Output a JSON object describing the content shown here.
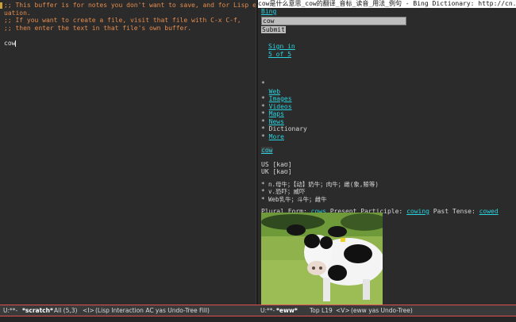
{
  "left_buffer": {
    "comment_lines": [
      ";; This buffer is for notes you don't want to save, and for Lisp eva",
      "uation.",
      ";; If you want to create a file, visit that file with C-x C-f,",
      ";; then enter the text in that file's own buffer."
    ],
    "body_text": "cow"
  },
  "right_buffer": {
    "title": "cow是什么意思_cow的翻译_音标_读音_用法_例句 - Bing Dictionary: http://cn.bing.",
    "bing_link": "Bing",
    "search_value": "cow",
    "submit_label": "Submit",
    "sign_in": "Sign in",
    "pager": "5 of 5",
    "nav": [
      {
        "bullet": "*",
        "label": ""
      },
      {
        "bullet": "",
        "label": "Web"
      },
      {
        "bullet": "*",
        "label": "Images"
      },
      {
        "bullet": "*",
        "label": "Videos"
      },
      {
        "bullet": "*",
        "label": "Maps"
      },
      {
        "bullet": "*",
        "label": "News"
      },
      {
        "bullet": "*",
        "label": "Dictionary"
      },
      {
        "bullet": "*",
        "label": "More"
      }
    ],
    "headword": "cow",
    "pron_us": "US [kaʊ]",
    "pron_uk": "UK [kaʊ]",
    "definitions": [
      "* n.母牛；【动】奶牛；肉牛；雌(象,鲸等)",
      "* v.恐吓；威吓",
      "* Web乳牛；斗牛；雌牛"
    ],
    "forms": {
      "plural_label": "Plural Form:",
      "plural": "cows",
      "present_label": "Present Participle:",
      "present": "cowing",
      "past_label": "Past Tense:",
      "past": "cowed"
    }
  },
  "mode_line": {
    "left": {
      "status": "U:**-",
      "buffer": "*scratch*",
      "position": "All (5,3)",
      "state": "<I>",
      "modes": "(Lisp Interaction AC yas Undo-Tree Fill)"
    },
    "right": {
      "status": "U:**-",
      "buffer": "*eww*",
      "position": "Top L19",
      "state": "<V>",
      "modes": "(eww yas Undo-Tree)"
    }
  },
  "colors": {
    "comment": "#e58c4e",
    "link": "#29d3e0",
    "modeline_border": "#e05050"
  }
}
